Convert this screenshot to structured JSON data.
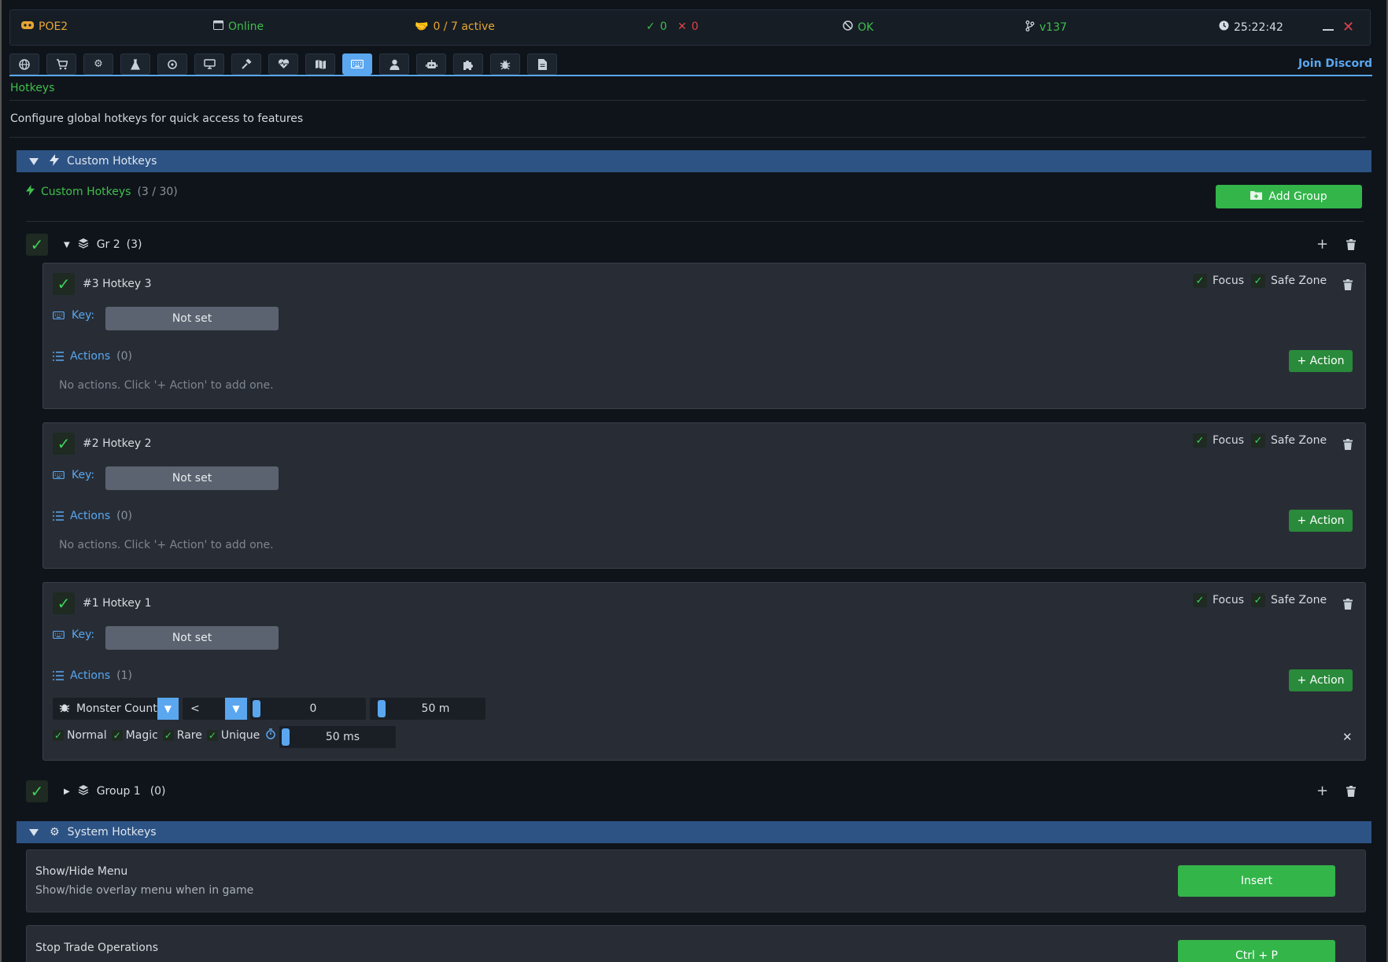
{
  "titlebar": {
    "app": "POE2",
    "status": "Online",
    "active": "0 / 7 active",
    "ok_count": "0",
    "err_count": "0",
    "health": "OK",
    "version": "v137",
    "time": "25:22:42"
  },
  "tabs": [
    "globe-icon",
    "cart-icon",
    "gear-icon",
    "flask-icon",
    "crosshair-icon",
    "monitor-icon",
    "hammer-icon",
    "heartbeat-icon",
    "map-icon",
    "keyboard-icon",
    "user-icon",
    "robot-icon",
    "puzzle-icon",
    "bug-icon",
    "file-icon"
  ],
  "join_discord": "Join Discord",
  "breadcrumb": "Hotkeys",
  "description": "Configure global hotkeys for quick access to features",
  "custom_section": {
    "title": "Custom Hotkeys",
    "label": "Custom Hotkeys",
    "count": "(3 / 30)",
    "add_group": "Add Group"
  },
  "group2": {
    "name": "Gr 2",
    "count": "(3)"
  },
  "group1": {
    "name": "Group 1",
    "count": "(0)"
  },
  "labels": {
    "focus": "Focus",
    "safe_zone": "Safe Zone",
    "key": "Key:",
    "not_set": "Not set",
    "actions": "Actions",
    "add_action": "+ Action",
    "no_actions": "No actions. Click '+ Action' to add one."
  },
  "hotkeys": [
    {
      "title": "#3 Hotkey 3",
      "action_count": "(0)"
    },
    {
      "title": "#2 Hotkey 2",
      "action_count": "(0)"
    },
    {
      "title": "#1 Hotkey 1",
      "action_count": "(1)"
    }
  ],
  "action1": {
    "type": "Monster Count",
    "operator": "<",
    "value": "0",
    "range": "50 m",
    "rarities": [
      "Normal",
      "Magic",
      "Rare",
      "Unique"
    ],
    "delay": "50 ms"
  },
  "system_section": {
    "title": "System Hotkeys",
    "items": [
      {
        "title": "Show/Hide Menu",
        "desc": "Show/hide overlay menu when in game",
        "key": "Insert"
      },
      {
        "title": "Stop Trade Operations",
        "desc": "",
        "key": "Ctrl + P"
      }
    ]
  },
  "colors": {
    "accent": "#5aa7f0",
    "green": "#33b54a",
    "section": "#2d5384",
    "bg": "#0f141a"
  }
}
